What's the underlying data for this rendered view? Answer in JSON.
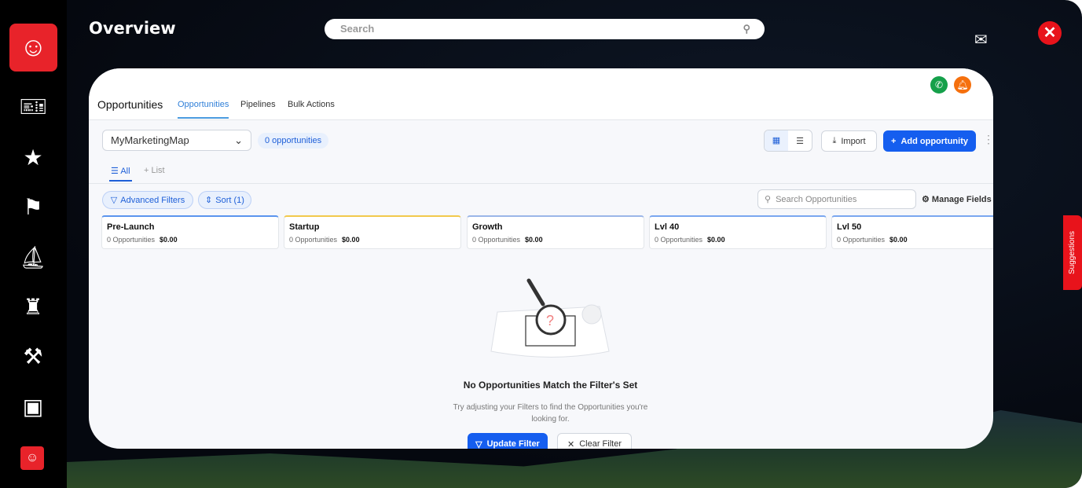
{
  "header": {
    "title": "Overview",
    "search_placeholder": "Search"
  },
  "sidebar": {
    "items": [
      "ticket-icon",
      "star-icon",
      "flag-icon",
      "sailboat-icon",
      "castle-icon",
      "pickaxe-icon",
      "chest-icon"
    ]
  },
  "suggestions_label": "Suggestions",
  "panel": {
    "heading": "Opportunities",
    "tabs": [
      "Opportunities",
      "Pipelines",
      "Bulk Actions"
    ],
    "pipeline_select": "MyMarketingMap",
    "count_badge": "0 opportunities",
    "import_label": "Import",
    "add_label": "Add opportunity",
    "view_tabs": [
      "All",
      "List"
    ],
    "advanced_filters": "Advanced Filters",
    "sort": "Sort (1)",
    "search_placeholder": "Search Opportunities",
    "manage_fields": "Manage Fields",
    "stages": [
      {
        "name": "Pre-Launch",
        "count": "0 Opportunities",
        "value": "$0.00",
        "color": "#5b95ee"
      },
      {
        "name": "Startup",
        "count": "0 Opportunities",
        "value": "$0.00",
        "color": "#f2c94c"
      },
      {
        "name": "Growth",
        "count": "0 Opportunities",
        "value": "$0.00",
        "color": "#9bb6e8"
      },
      {
        "name": "Lvl 40",
        "count": "0 Opportunities",
        "value": "$0.00",
        "color": "#7aa7f0"
      },
      {
        "name": "Lvl 50",
        "count": "0 Opportunities",
        "value": "$0.00",
        "color": "#7aa7f0"
      }
    ],
    "empty_title": "No Opportunities Match the Filter's Set",
    "empty_text": "Try adjusting your Filters to find the Opportunities you're looking for.",
    "update_filter": "Update Filter",
    "clear_filter": "Clear Filter"
  }
}
